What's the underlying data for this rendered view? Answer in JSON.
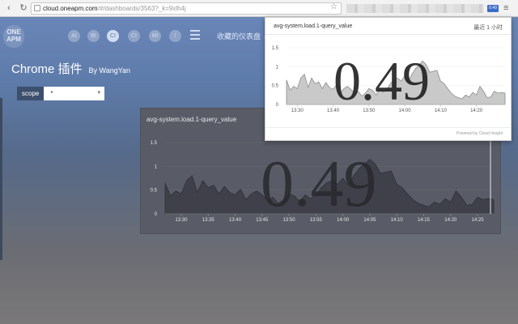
{
  "browser": {
    "url_host": "cloud.oneapm.com",
    "url_path": "/#/dashboards/3563?_k=9xlh4j",
    "ext_badge": "0.49"
  },
  "app": {
    "logo_line1": "ONE",
    "logo_line2": "APM",
    "nav": [
      {
        "label": "AI",
        "active": false
      },
      {
        "label": "BI",
        "active": false
      },
      {
        "label": "CI",
        "active": true
      },
      {
        "label": "CI",
        "active": false
      },
      {
        "label": "MI",
        "active": false
      }
    ],
    "favorites_label": "收藏的仪表盘 ⌄",
    "page_title": "Chrome 插件",
    "page_by": "By  WangYan",
    "scope_label": "scope",
    "scope_value": "*"
  },
  "widget": {
    "title": "avg-system.load.1-query_value",
    "big_value": "0.49",
    "y_ticks": [
      "1.5",
      "1",
      "0.5",
      "0"
    ],
    "x_ticks": [
      "13:30",
      "13:35",
      "13:40",
      "13:45",
      "13:50",
      "13:55",
      "14:00",
      "14:05",
      "14:10",
      "14:15",
      "14:20",
      "14:25"
    ]
  },
  "popup": {
    "title": "avg-system.load.1-query_value",
    "range": "最近 1 小时",
    "big_value": "0.49",
    "y_ticks": [
      "1.5",
      "1",
      "0.5",
      "0"
    ],
    "x_ticks": [
      "13:30",
      "13:40",
      "13:50",
      "14:00",
      "14:10",
      "14:20"
    ],
    "footer": "Powered by Cloud Insight"
  },
  "chart_data": [
    {
      "type": "area",
      "title": "avg-system.load.1-query_value",
      "x_start": "13:27",
      "x_end": "14:28",
      "x_step_minutes": 1,
      "ylim": [
        0,
        1.5
      ],
      "values": [
        0.65,
        0.38,
        0.48,
        0.42,
        0.7,
        0.8,
        0.45,
        0.7,
        0.55,
        0.6,
        0.42,
        0.58,
        0.45,
        0.4,
        0.52,
        0.3,
        0.42,
        0.48,
        0.4,
        0.28,
        0.35,
        0.22,
        0.3,
        0.42,
        0.38,
        0.25,
        0.4,
        0.32,
        0.4,
        0.55,
        0.65,
        0.7,
        0.62,
        0.75,
        0.6,
        0.8,
        0.95,
        1.05,
        1.15,
        1.05,
        0.85,
        0.88,
        0.9,
        0.62,
        0.55,
        0.42,
        0.3,
        0.22,
        0.18,
        0.15,
        0.25,
        0.2,
        0.32,
        0.25,
        0.48,
        0.35,
        0.18,
        0.2,
        0.35,
        0.3,
        0.32,
        0.3
      ]
    }
  ]
}
